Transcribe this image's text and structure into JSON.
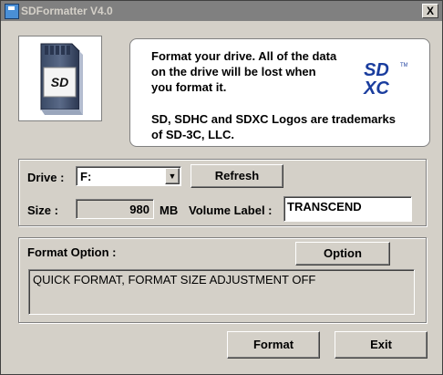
{
  "window": {
    "title": "SDFormatter V4.0",
    "close_glyph": "X"
  },
  "sd_card": {
    "logo": "SD"
  },
  "info": {
    "line1": "Format your drive. All of the data",
    "line2": "on the drive will be lost when",
    "line3": "you format it.",
    "line4": "SD, SDHC and SDXC Logos are trademarks",
    "line5": "of SD-3C, LLC.",
    "logo_top": "SD",
    "logo_bottom": "XC",
    "logo_tm": "TM"
  },
  "drive": {
    "label": "Drive :",
    "selected": "F:",
    "refresh_label": "Refresh",
    "size_label": "Size :",
    "size_value": "980",
    "size_unit": "MB",
    "volume_label": "Volume Label :",
    "volume_value": "TRANSCEND"
  },
  "format_option": {
    "label": "Format Option :",
    "option_button": "Option",
    "status": "QUICK FORMAT, FORMAT SIZE ADJUSTMENT OFF"
  },
  "actions": {
    "format_label": "Format",
    "exit_label": "Exit"
  },
  "colors": {
    "sd_blue": "#1a3d9e",
    "titlebar": "#808080",
    "dialog": "#d4d0c8"
  }
}
